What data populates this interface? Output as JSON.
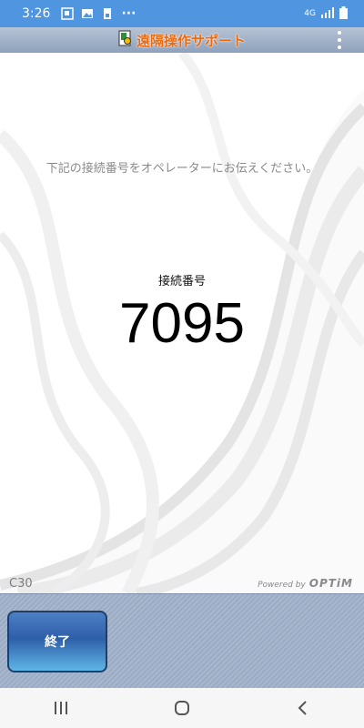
{
  "status_bar": {
    "time": "3:26",
    "more": "···",
    "network": "4G",
    "icons": [
      "app-notification-icon",
      "image-icon",
      "sim-icon",
      "signal-icon",
      "battery-icon"
    ]
  },
  "header": {
    "title": "遠隔操作サポート",
    "logo_icon": "app-logo-icon",
    "menu_icon": "more-vertical-icon"
  },
  "main": {
    "instruction": "下記の接続番号をオペレーターにお伝えください。",
    "connection_label": "接続番号",
    "connection_number": "7095",
    "version": "C30",
    "powered_prefix": "Powered by",
    "powered_brand": "OPTiM"
  },
  "footer": {
    "end_button": "終了"
  },
  "nav": {
    "icons": [
      "recent-apps-icon",
      "home-icon",
      "back-icon"
    ]
  },
  "colors": {
    "status_bar": "#4f95df",
    "title": "#ea6a12",
    "header": "#9fb0c8",
    "button": "#2e5fa9"
  }
}
